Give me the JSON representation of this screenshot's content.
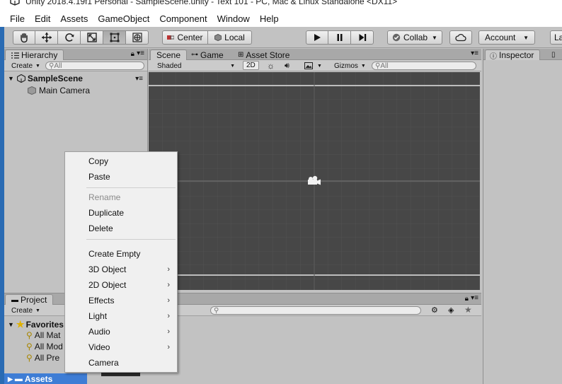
{
  "window": {
    "title": "Unity 2018.4.19f1 Personal - SampleScene.unity - Text 101 - PC, Mac & Linux Standalone <DX11>"
  },
  "menubar": [
    "File",
    "Edit",
    "Assets",
    "GameObject",
    "Component",
    "Window",
    "Help"
  ],
  "toolbar": {
    "pivot_label": "Center",
    "space_label": "Local",
    "collab_label": "Collab",
    "account_label": "Account",
    "layers_label": "La"
  },
  "hierarchy": {
    "tab_label": "Hierarchy",
    "create_label": "Create",
    "search_placeholder": "All",
    "scene_name": "SampleScene",
    "items": [
      "Main Camera"
    ]
  },
  "scene": {
    "tabs": [
      "Scene",
      "Game",
      "Asset Store"
    ],
    "shading_label": "Shaded",
    "mode_2d_label": "2D",
    "gizmos_label": "Gizmos",
    "search_placeholder": "All"
  },
  "inspector": {
    "tab_label": "Inspector"
  },
  "project": {
    "tab_label": "Project",
    "create_label": "Create",
    "favorites_label": "Favorites",
    "favorites_items": [
      "All Mat",
      "All Mod",
      "All Pre"
    ],
    "assets_label": "Assets"
  },
  "context_menu": {
    "items": [
      {
        "label": "Copy",
        "disabled": false,
        "submenu": false
      },
      {
        "label": "Paste",
        "disabled": false,
        "submenu": false
      },
      {
        "label": "Rename",
        "disabled": true,
        "submenu": false
      },
      {
        "label": "Duplicate",
        "disabled": false,
        "submenu": false
      },
      {
        "label": "Delete",
        "disabled": false,
        "submenu": false
      },
      {
        "label": "Create Empty",
        "disabled": false,
        "submenu": false
      },
      {
        "label": "3D Object",
        "disabled": false,
        "submenu": true
      },
      {
        "label": "2D Object",
        "disabled": false,
        "submenu": true
      },
      {
        "label": "Effects",
        "disabled": false,
        "submenu": true
      },
      {
        "label": "Light",
        "disabled": false,
        "submenu": true
      },
      {
        "label": "Audio",
        "disabled": false,
        "submenu": true
      },
      {
        "label": "Video",
        "disabled": false,
        "submenu": true
      },
      {
        "label": "Camera",
        "disabled": false,
        "submenu": false
      }
    ]
  },
  "colors": {
    "panel_bg": "#c2c2c2",
    "scene_bg": "#474747",
    "menu_bg": "#f0f0f0",
    "desktop_edge": "#2a6bb3"
  }
}
